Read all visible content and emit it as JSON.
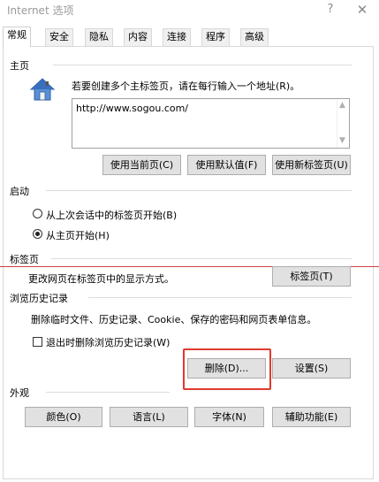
{
  "window": {
    "title": "Internet 选项",
    "help": "?",
    "close": "✕"
  },
  "tabs": [
    "常规",
    "安全",
    "隐私",
    "内容",
    "连接",
    "程序",
    "高级"
  ],
  "home": {
    "group_label": "主页",
    "instruction": "若要创建多个主标签页，请在每行输入一个地址(R)。",
    "url": "http://www.sogou.com/",
    "buttons": {
      "current": "使用当前页(C)",
      "default": "使用默认值(F)",
      "new_tab": "使用新标签页(U)"
    }
  },
  "startup": {
    "group_label": "启动",
    "option_last_session": "从上次会话中的标签页开始(B)",
    "option_home": "从主页开始(H)",
    "selected": "home"
  },
  "tabs_section": {
    "group_label": "标签页",
    "description": "更改网页在标签页中的显示方式。",
    "button": "标签页(T)"
  },
  "history": {
    "group_label": "浏览历史记录",
    "description": "删除临时文件、历史记录、Cookie、保存的密码和网页表单信息。",
    "checkbox_label": "退出时删除浏览历史记录(W)",
    "checkbox_checked": false,
    "delete_button": "删除(D)...",
    "settings_button": "设置(S)"
  },
  "appearance": {
    "group_label": "外观",
    "buttons": {
      "colors": "颜色(O)",
      "languages": "语言(L)",
      "fonts": "字体(N)",
      "accessibility": "辅助功能(E)"
    }
  },
  "colors": {
    "highlight": "#e0392f",
    "annotation_line": "#d04040"
  }
}
